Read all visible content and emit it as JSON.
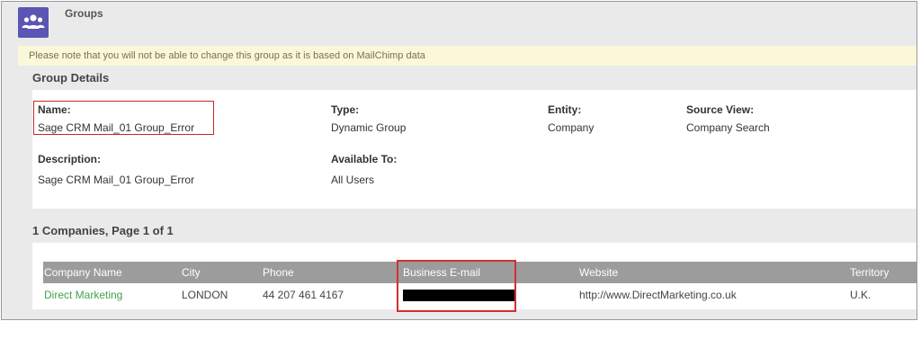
{
  "page": {
    "title": "Groups",
    "icon": "group-icon",
    "notice": "Please note that you will not be able to change this group as it is based on MailChimp data"
  },
  "group_details": {
    "heading": "Group Details",
    "name_label": "Name:",
    "name_value": "Sage CRM Mail_01 Group_Error",
    "type_label": "Type:",
    "type_value": "Dynamic Group",
    "entity_label": "Entity:",
    "entity_value": "Company",
    "source_view_label": "Source View:",
    "source_view_value": "Company Search",
    "description_label": "Description:",
    "description_value": "Sage CRM Mail_01 Group_Error",
    "available_to_label": "Available To:",
    "available_to_value": "All Users"
  },
  "companies": {
    "heading": "1 Companies, Page 1 of 1",
    "columns": [
      "Company Name",
      "City",
      "Phone",
      "Business E-mail",
      "Website",
      "Territory"
    ],
    "rows": [
      {
        "company_name": "Direct Marketing",
        "city": "LONDON",
        "phone": "44 207 461 4167",
        "business_email": "",
        "website": "http://www.DirectMarketing.co.uk",
        "territory": "U.K."
      }
    ]
  },
  "colors": {
    "icon_bg": "#5b55b3",
    "notice_bg": "#fbf7d9",
    "header_bg": "#9c9c9c",
    "link": "#3fa34d",
    "highlight": "#d32f2f"
  }
}
